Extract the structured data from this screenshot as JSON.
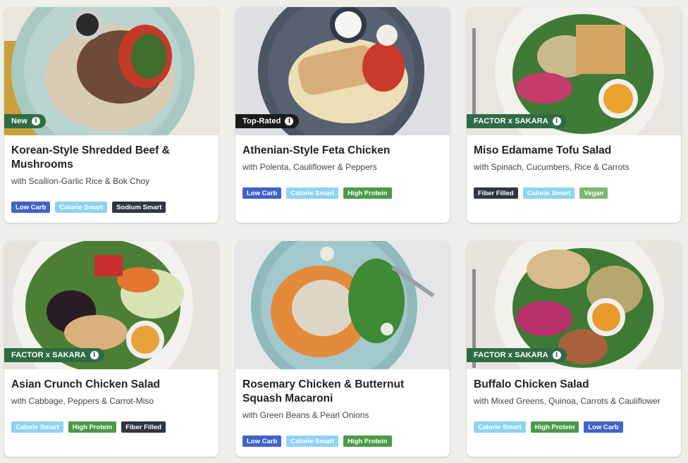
{
  "cards": [
    {
      "ribbon": "New",
      "title": "Korean-Style Shredded Beef & Mushrooms",
      "subtitle": "with Scallion-Garlic Rice & Bok Choy",
      "tags": [
        "Low Carb",
        "Calorie Smart",
        "Sodium Smart"
      ]
    },
    {
      "ribbon": "Top-Rated",
      "title": "Athenian-Style Feta Chicken",
      "subtitle": "with Polenta, Cauliflower & Peppers",
      "tags": [
        "Low Carb",
        "Calorie Smart",
        "High Protein"
      ]
    },
    {
      "ribbon": "FACTOR x SAKARA",
      "title": "Miso Edamame Tofu Salad",
      "subtitle": "with Spinach, Cucumbers, Rice & Carrots",
      "tags": [
        "Fiber Filled",
        "Calorie Smart",
        "Vegan"
      ]
    },
    {
      "ribbon": "FACTOR x SAKARA",
      "title": "Asian Crunch Chicken Salad",
      "subtitle": "with Cabbage, Peppers & Carrot-Miso",
      "tags": [
        "Calorie Smart",
        "High Protein",
        "Fiber Filled"
      ]
    },
    {
      "ribbon": "",
      "title": "Rosemary Chicken & Butternut Squash Macaroni",
      "subtitle": "with Green Beans & Pearl Onions",
      "tags": [
        "Low Carb",
        "Calorie Smart",
        "High Protein"
      ]
    },
    {
      "ribbon": "FACTOR x SAKARA",
      "title": "Buffalo Chicken Salad",
      "subtitle": "with Mixed Greens, Quinoa, Carrots & Cauliflower",
      "tags": [
        "Calorie Smart",
        "High Protein",
        "Low Carb"
      ]
    }
  ],
  "info_glyph": "i",
  "colors": {
    "ribbon_green": "#2f6b45",
    "ribbon_black": "#1b1b1b",
    "tag_low_carb": "#4063c8",
    "tag_calorie_smart": "#8dd3f2",
    "tag_high_protein": "#4a9a4a",
    "tag_dark": "#2f3640",
    "tag_vegan": "#7cb86e"
  }
}
